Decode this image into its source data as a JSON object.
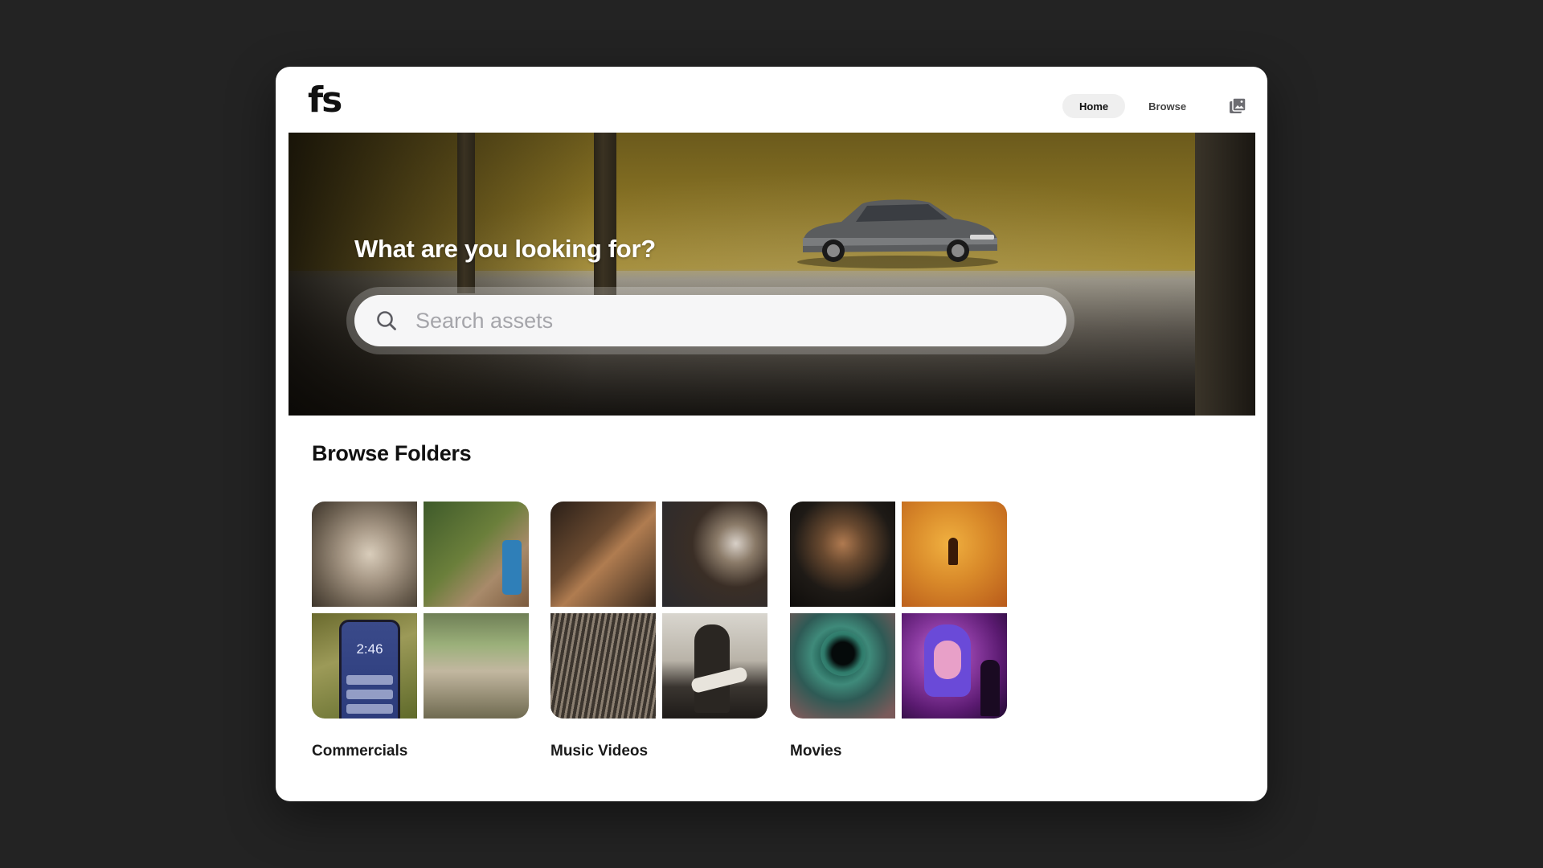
{
  "header": {
    "logo": "fs",
    "nav": [
      {
        "label": "Home",
        "active": true
      },
      {
        "label": "Browse",
        "active": false
      }
    ],
    "gallery_icon": "photo-library-icon"
  },
  "hero": {
    "title": "What are you looking for?",
    "search": {
      "placeholder": "Search assets",
      "value": "",
      "icon": "search-icon"
    }
  },
  "browse": {
    "title": "Browse Folders",
    "folders": [
      {
        "name": "Commercials"
      },
      {
        "name": "Music Videos"
      },
      {
        "name": "Movies"
      }
    ],
    "phone_time": "2:46"
  },
  "colors": {
    "background": "#232323",
    "window": "#ffffff",
    "nav_active_bg": "#efefef",
    "search_bg": "#f6f6f7"
  }
}
